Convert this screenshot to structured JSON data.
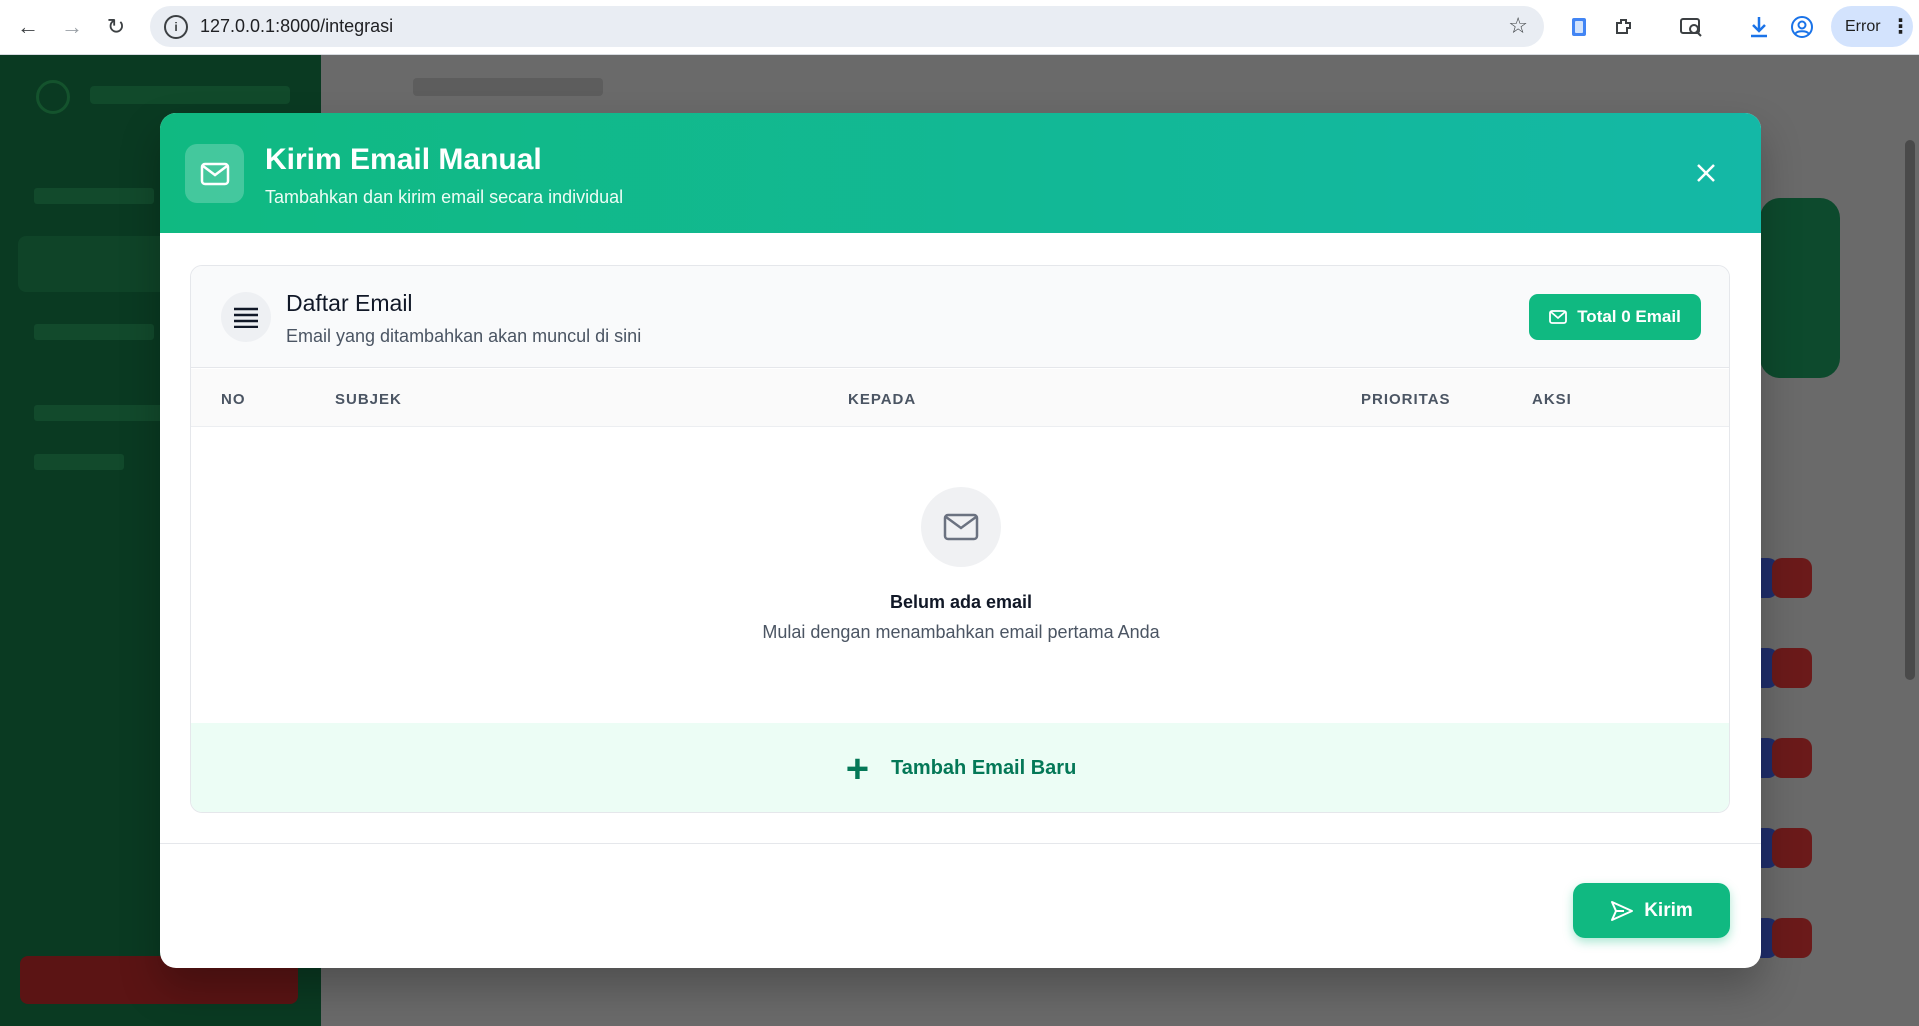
{
  "browser": {
    "url": "127.0.0.1:8000/integrasi",
    "profile_status": "Error"
  },
  "modal": {
    "title": "Kirim Email Manual",
    "subtitle": "Tambahkan dan kirim email secara individual",
    "list": {
      "title": "Daftar Email",
      "subtitle": "Email yang ditambahkan akan muncul di sini",
      "total_badge": "Total 0 Email"
    },
    "table": {
      "columns": [
        "NO",
        "SUBJEK",
        "KEPADA",
        "PRIORITAS",
        "AKSI"
      ]
    },
    "empty": {
      "title": "Belum ada email",
      "subtitle": "Mulai dengan menambahkan email pertama Anda"
    },
    "add_button": "Tambah Email Baru",
    "send_button": "Kirim"
  },
  "colors": {
    "primary": "#10b981",
    "primary_dark": "#047857",
    "header_end": "#14b8a6"
  }
}
